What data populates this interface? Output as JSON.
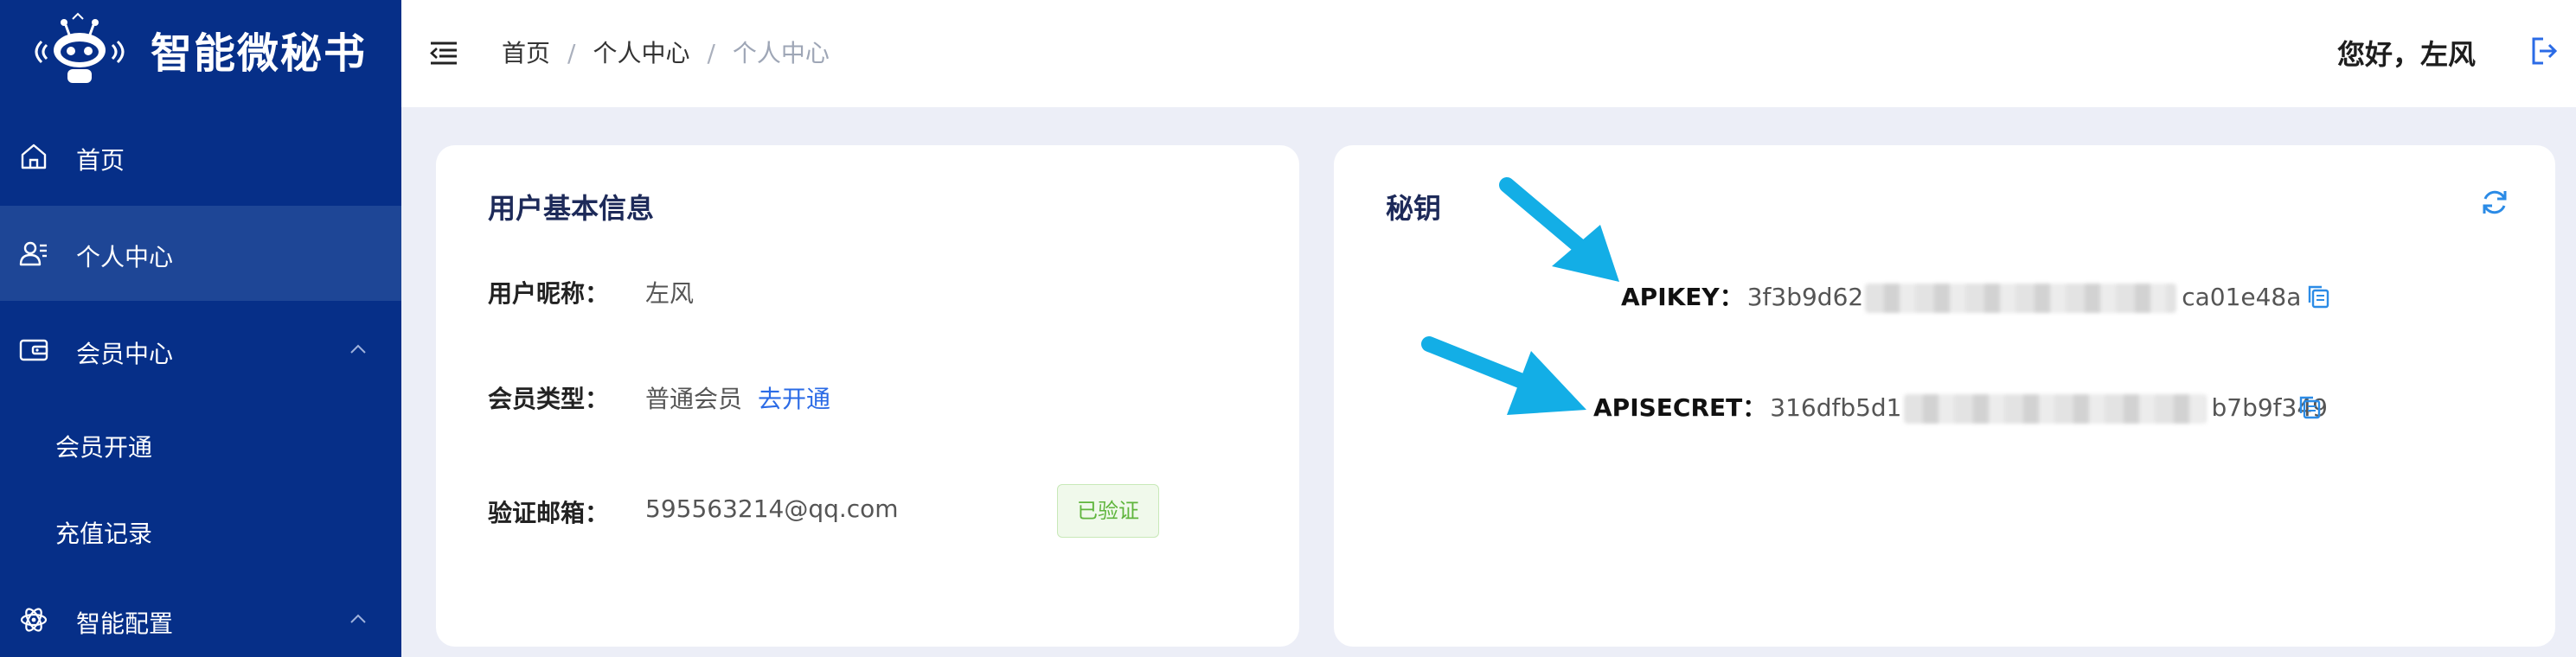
{
  "app": {
    "brand_name": "智能微秘书"
  },
  "sidebar": {
    "items": [
      {
        "label": "首页",
        "icon": "home-icon"
      },
      {
        "label": "个人中心",
        "icon": "user-card-icon",
        "active": true
      },
      {
        "label": "会员中心",
        "icon": "wallet-icon",
        "expanded": true
      },
      {
        "label": "会员开通"
      },
      {
        "label": "充值记录"
      },
      {
        "label": "智能配置",
        "icon": "atom-icon",
        "expanded": true
      }
    ]
  },
  "header": {
    "breadcrumb": [
      "首页",
      "个人中心",
      "个人中心"
    ],
    "greeting": "您好，左风"
  },
  "user_card": {
    "title": "用户基本信息",
    "nickname_label": "用户昵称：",
    "nickname": "左风",
    "member_type_label": "会员类型：",
    "member_type": "普通会员",
    "upgrade_link": "去开通",
    "email_label": "验证邮箱：",
    "email": "595563214@qq.com",
    "email_status": "已验证"
  },
  "key_card": {
    "title": "秘钥",
    "apikey_label": "APIKEY：",
    "apikey_start": "3f3b9d62",
    "apikey_end": "ca01e48a",
    "apisecret_label": "APISECRET：",
    "apisecret_start": "316dfb5d1",
    "apisecret_end": "b7b9f349"
  },
  "colors": {
    "sidebar_bg": "#062f88",
    "sidebar_active": "#1e4696",
    "page_bg": "#eceef7",
    "link": "#2b6be6",
    "success": "#5fb53c",
    "annotation_arrow": "#13aee6"
  }
}
